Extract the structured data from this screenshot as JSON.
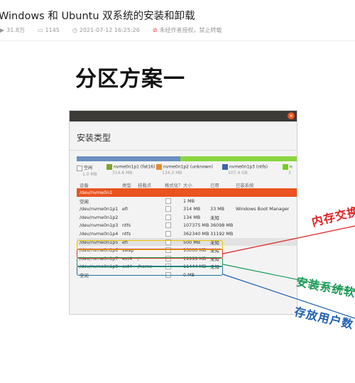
{
  "article": {
    "title": "Windows 和 Ubuntu 双系统的安装和卸载",
    "views": "31.8万",
    "comments": "1145",
    "date": "2021-07-12 16:25:26",
    "copyright": "未经作者授权，禁止转载"
  },
  "heading": "分区方案一",
  "installer": {
    "title": "安装类型",
    "colors": {
      "efi": "#7da42b",
      "unknown": "#e8882f",
      "ntfs": "#3b64a8",
      "ext4": "#73d216",
      "free": "#ffffff",
      "selected": "#e95420"
    },
    "bar": [
      {
        "name": "free",
        "color": "#ffffff",
        "frac": 0.0
      },
      {
        "name": "ntfs",
        "color": "#6b8fc0",
        "frac": 0.47
      },
      {
        "name": "ext4",
        "color": "#8ad63e",
        "frac": 0.53
      }
    ],
    "legend": [
      {
        "label": "空闲",
        "size": "1.0 MB",
        "color": "#ffffff"
      },
      {
        "label": "nvme0n1p1 (fat16)",
        "size": "314.6 MB",
        "color": "#7da42b"
      },
      {
        "label": "nvme0n1p2 (unknown)",
        "size": "134.2 MB",
        "color": "#e8882f"
      },
      {
        "label": "nvme0n1p3 (ntfs)",
        "size": "107.4 GB",
        "color": "#3b64a8"
      },
      {
        "label": "n",
        "size": "3",
        "color": "#73d216"
      }
    ],
    "columns": [
      "设备",
      "类型",
      "挂载点",
      "格式化？",
      "大小",
      "已用",
      "已装系统"
    ],
    "rows": [
      {
        "device": "/dev/nvme0n1",
        "type": "",
        "mount": "",
        "format": "",
        "size": "",
        "used": "",
        "system": "",
        "style": "sel"
      },
      {
        "device": "空闲",
        "type": "",
        "mount": "",
        "format": "none",
        "size": "1 MB",
        "used": "",
        "system": "",
        "style": ""
      },
      {
        "device": "/dev/nvme0n1p1",
        "type": "efi",
        "mount": "",
        "format": "none",
        "size": "314 MB",
        "used": "33 MB",
        "system": "Windows Boot Manager",
        "style": ""
      },
      {
        "device": "/dev/nvme0n1p2",
        "type": "",
        "mount": "",
        "format": "none",
        "size": "134 MB",
        "used": "未知",
        "system": "",
        "style": ""
      },
      {
        "device": "/dev/nvme0n1p3",
        "type": "ntfs",
        "mount": "",
        "format": "none",
        "size": "107375 MB",
        "used": "36098 MB",
        "system": "",
        "style": ""
      },
      {
        "device": "/dev/nvme0n1p4",
        "type": "ntfs",
        "mount": "",
        "format": "none",
        "size": "362340 MB",
        "used": "31192 MB",
        "system": "",
        "style": ""
      },
      {
        "device": "/dev/nvme0n1p5",
        "type": "efi",
        "mount": "",
        "format": "none",
        "size": "500 MB",
        "used": "未知",
        "system": "",
        "style": "gray"
      },
      {
        "device": "/dev/nvme0n1p6",
        "type": "swap",
        "mount": "",
        "format": "none",
        "size": "10000 MB",
        "used": "未知",
        "system": "",
        "style": ""
      },
      {
        "device": "/dev/nvme0n1p7",
        "type": "ext4",
        "mount": "/",
        "format": "checked",
        "size": "19999 MB",
        "used": "未知",
        "system": "",
        "style": ""
      },
      {
        "device": "/dev/nvme0n1p8",
        "type": "ext4",
        "mount": "/home",
        "format": "checked",
        "size": "11444 MB",
        "used": "未知",
        "system": "",
        "style": ""
      },
      {
        "device": "空闲",
        "type": "",
        "mount": "",
        "format": "none",
        "size": "0 MB",
        "used": "",
        "system": "",
        "style": ""
      }
    ]
  },
  "annotations": [
    {
      "text": "内存交换",
      "color": "#e02020"
    },
    {
      "text": "安装系统软",
      "color": "#1a9a56"
    },
    {
      "text": "存放用户数",
      "color": "#1f5fb0"
    }
  ]
}
